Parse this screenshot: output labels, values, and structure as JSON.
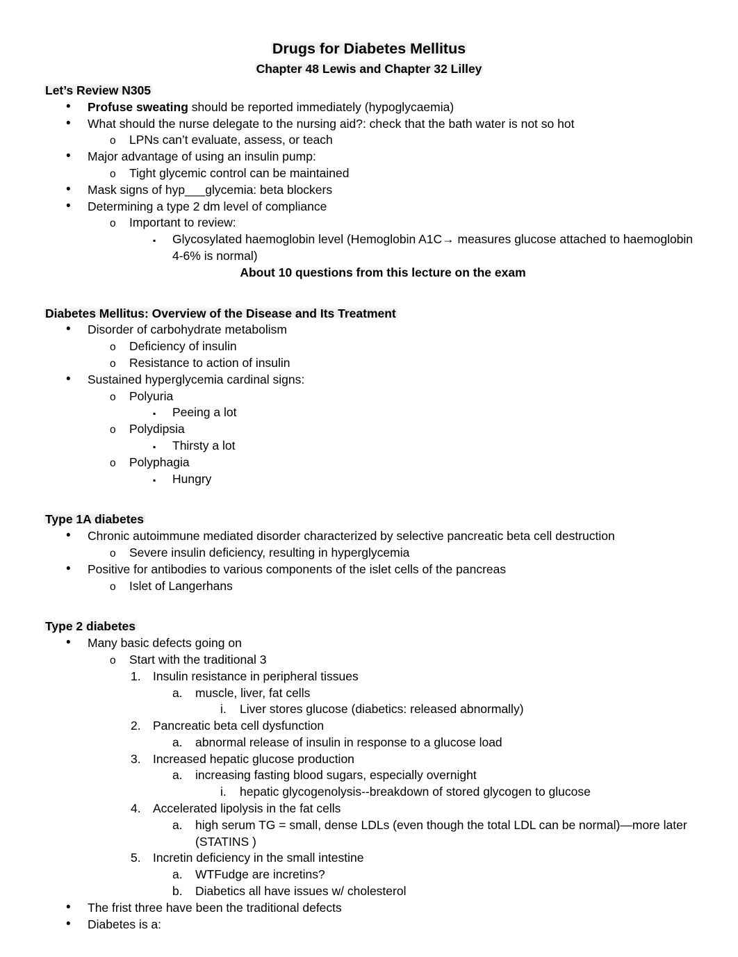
{
  "document": {
    "title": "Drugs for Diabetes Mellitus",
    "subtitle": "Chapter 48 Lewis and Chapter 32 Lilley"
  },
  "markers": {
    "bullet": "•",
    "circle": "o",
    "square": "▪",
    "n1": "1.",
    "n2": "2.",
    "n3": "3.",
    "n4": "4.",
    "n5": "5.",
    "a": "a.",
    "b": "b.",
    "i": "i."
  },
  "sections": {
    "review": {
      "heading": "Let’s Review N305",
      "items": {
        "profuse_bold": "Profuse sweating",
        "profuse_rest": " should be reported immediately (hypoglycaemia)",
        "delegate": "What should the nurse delegate to the nursing aid?: check that the bath water is not so hot",
        "lpns": "LPNs can’t evaluate, assess, or teach",
        "pump": "Major advantage of using an insulin pump:",
        "glycemic": "Tight glycemic control can be maintained",
        "mask": "Mask signs of hyp___glycemia: beta blockers",
        "compliance": "Determining a type 2 dm level of compliance",
        "important": "Important to review:",
        "a1c": "Glycosylated haemoglobin level (Hemoglobin A1C→ measures glucose attached to haemoglobin 4-6% is normal)",
        "exam_note": "About 10 questions from this lecture on the exam"
      }
    },
    "overview": {
      "heading": "Diabetes Mellitus: Overview of the Disease and Its Treatment",
      "items": {
        "disorder": "Disorder of carbohydrate metabolism",
        "deficiency": "Deficiency of insulin",
        "resistance": "Resistance to action of insulin",
        "sustained": "Sustained hyperglycemia cardinal signs:",
        "polyuria": "Polyuria",
        "polyuria_sub": "Peeing a lot",
        "polydipsia": "Polydipsia",
        "polydipsia_sub": "Thirsty a lot",
        "polyphagia": "Polyphagia",
        "polyphagia_sub": "Hungry"
      }
    },
    "type1a": {
      "heading": "Type 1A diabetes",
      "items": {
        "chronic": "Chronic autoimmune mediated disorder characterized by selective pancreatic beta cell destruction",
        "severe": "Severe insulin deficiency, resulting in hyperglycemia",
        "positive": "Positive for antibodies to various components of the islet cells of the pancreas",
        "islet": "Islet of Langerhans"
      }
    },
    "type2": {
      "heading": "Type 2 diabetes",
      "items": {
        "many_defects": "Many basic defects going on",
        "traditional3": "Start with the traditional 3",
        "d1": "Insulin resistance in peripheral tissues",
        "d1a": "muscle, liver, fat cells",
        "d1ai": "Liver stores glucose (diabetics: released abnormally)",
        "d2": "Pancreatic beta cell dysfunction",
        "d2a": "abnormal release of insulin in response to a glucose load",
        "d3": "Increased hepatic glucose production",
        "d3a": "increasing fasting blood sugars, especially overnight",
        "d3ai": "hepatic glycogenolysis--breakdown of stored glycogen to glucose",
        "d4": "Accelerated lipolysis in the fat cells",
        "d4a": "high serum TG = small, dense LDLs (even though the total LDL can be normal)—more later (STATINS )",
        "d5": "Incretin deficiency in the small intestine",
        "d5a": "WTFudge are incretins?",
        "d5b": "Diabetics all have issues w/ cholesterol",
        "frist_three": "The frist three have been the traditional defects",
        "diabetes_is": "Diabetes is a:"
      }
    }
  }
}
